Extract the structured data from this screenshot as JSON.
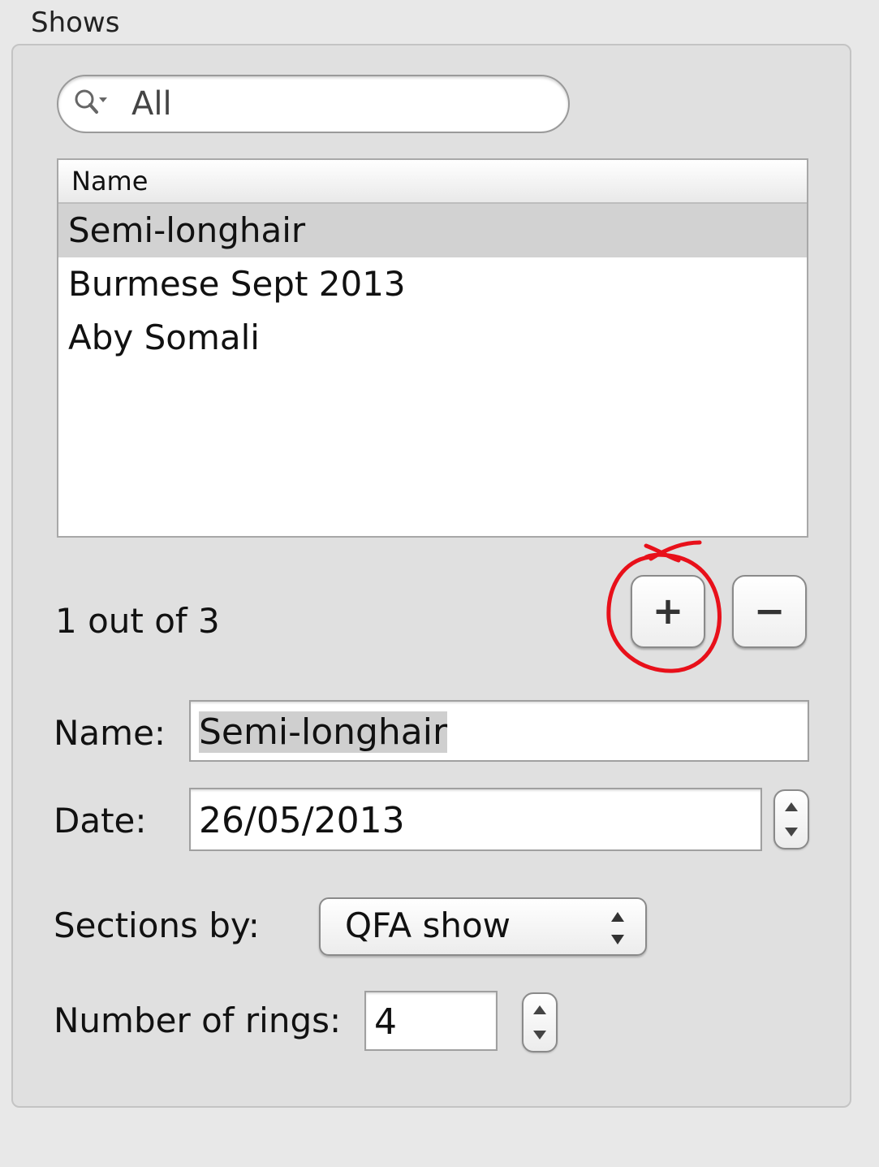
{
  "group": {
    "title": "Shows"
  },
  "search": {
    "value": "All",
    "icon": "search-icon"
  },
  "table": {
    "column_header": "Name",
    "rows": [
      "Semi-longhair",
      "Burmese Sept 2013",
      "Aby Somali"
    ],
    "selected_index": 0
  },
  "count_text": "1 out of 3",
  "buttons": {
    "add": "+",
    "remove": "−"
  },
  "annotation_color": "#e8101a",
  "form": {
    "name_label": "Name:",
    "name_value": "Semi-longhair",
    "date_label": "Date:",
    "date_value": "26/05/2013",
    "sections_label": "Sections by:",
    "sections_value": "QFA show",
    "rings_label": "Number of rings:",
    "rings_value": "4"
  }
}
